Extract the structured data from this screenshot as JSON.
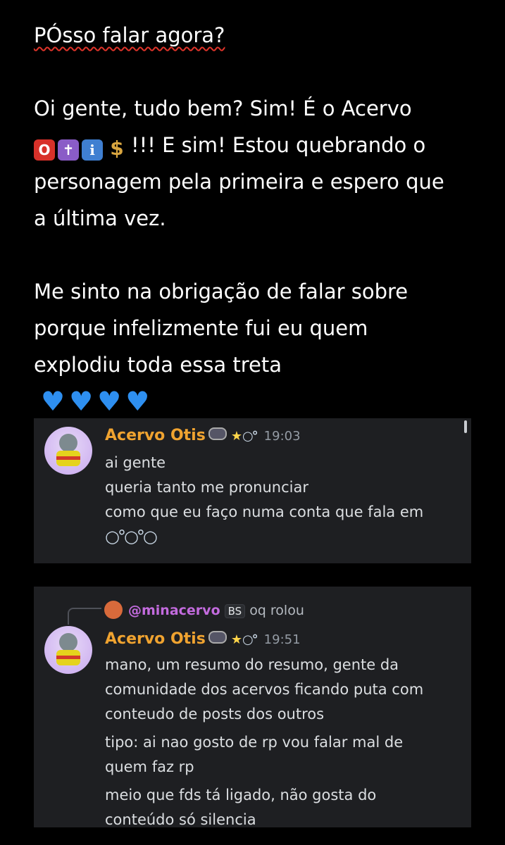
{
  "post": {
    "line1": "PÓsso falar agora?",
    "para2_lead": "Oi gente, tudo bem? Sim! É o Acervo",
    "emojis": [
      "O",
      "✝",
      "i",
      "$"
    ],
    "para2_after_emoji": "!!! E sim! Estou quebrando o",
    "para2_line3": "personagem pela primeira e espero que",
    "para2_line4": "a última vez.",
    "para3_line1": "Me sinto na obrigação de falar sobre",
    "para3_line2": "porque infelizmente fui eu quem",
    "para3_line3": "explodiu toda essa treta",
    "hearts": [
      "♥",
      "♥",
      "♥",
      "♥"
    ]
  },
  "card1": {
    "username": "Acervo Otis",
    "star": "★",
    "bubbles": "○°",
    "time": "19:03",
    "lines": [
      "ai gente",
      "queria tanto me pronunciar",
      "como que eu faço numa conta que fala em"
    ],
    "bubble_row": "○°○°○"
  },
  "card2": {
    "reply_mention": "@minacervo",
    "reply_tag": "BS",
    "reply_text": "oq rolou",
    "username": "Acervo Otis",
    "star": "★",
    "bubbles": "○°",
    "time": "19:51",
    "lines": [
      "mano, um resumo do resumo, gente da",
      "comunidade dos acervos ficando puta com",
      "conteudo de posts dos outros",
      "tipo: ai nao gosto de rp vou falar mal de",
      "quem faz rp",
      "meio que fds tá ligado, não gosta do",
      "conteúdo só silencia"
    ]
  },
  "colors": {
    "background": "#000000",
    "card": "#1e1f22",
    "username": "#f0a330",
    "mention": "#c36bde",
    "heart": "#2e8ff0"
  }
}
